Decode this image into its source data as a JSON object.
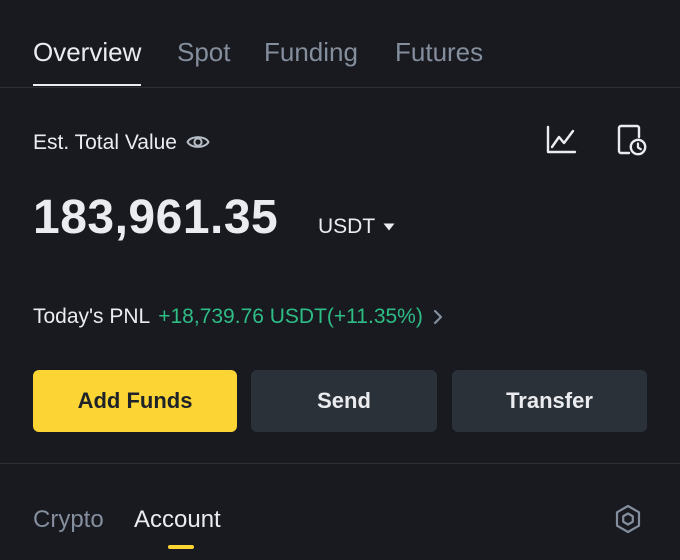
{
  "top_tabs": [
    {
      "label": "Overview",
      "active": true
    },
    {
      "label": "Spot",
      "active": false
    },
    {
      "label": "Funding",
      "active": false
    },
    {
      "label": "Futures",
      "active": false
    }
  ],
  "summary": {
    "est_label": "Est. Total Value",
    "visibility_icon": "eye-icon",
    "chart_icon": "line-chart-icon",
    "history_icon": "document-clock-icon",
    "balance": "183,961.35",
    "currency": "USDT",
    "currency_icon": "caret-down-icon"
  },
  "pnl": {
    "label": "Today's PNL",
    "value": "+18,739.76 USDT(+11.35%)",
    "chevron_icon": "chevron-right-icon"
  },
  "actions": {
    "add_funds": "Add Funds",
    "send": "Send",
    "transfer": "Transfer"
  },
  "sub_tabs": [
    {
      "label": "Crypto",
      "active": false
    },
    {
      "label": "Account",
      "active": true
    }
  ],
  "settings_icon": "hexagon-settings-icon",
  "colors": {
    "background": "#181a20",
    "accent_yellow": "#fcd535",
    "positive_green": "#2ebd85",
    "button_gray": "#2b3139",
    "muted_text": "#848e9c",
    "primary_text": "#eaecef"
  }
}
